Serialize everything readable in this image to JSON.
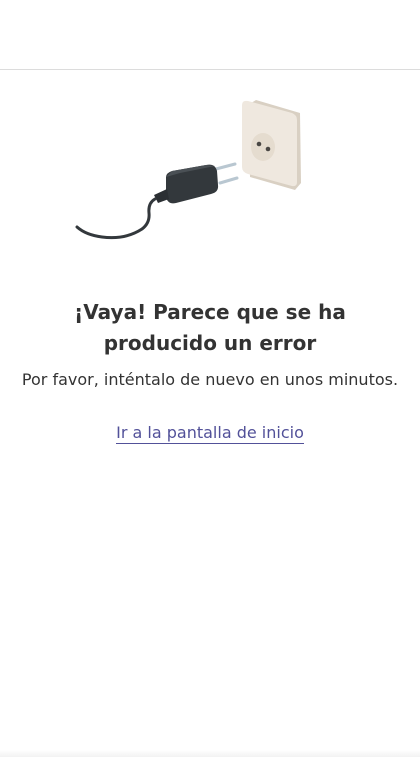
{
  "error": {
    "title": "¡Vaya! Parece que se ha producido un error",
    "message": "Por favor, inténtalo de nuevo en unos minutos.",
    "home_link_label": "Ir a la pantalla de inicio",
    "illustration_icon": "unplugged-charger-icon"
  },
  "colors": {
    "text": "#333333",
    "link": "#525199",
    "charger": "#33383c",
    "socket": "#efe8df"
  }
}
